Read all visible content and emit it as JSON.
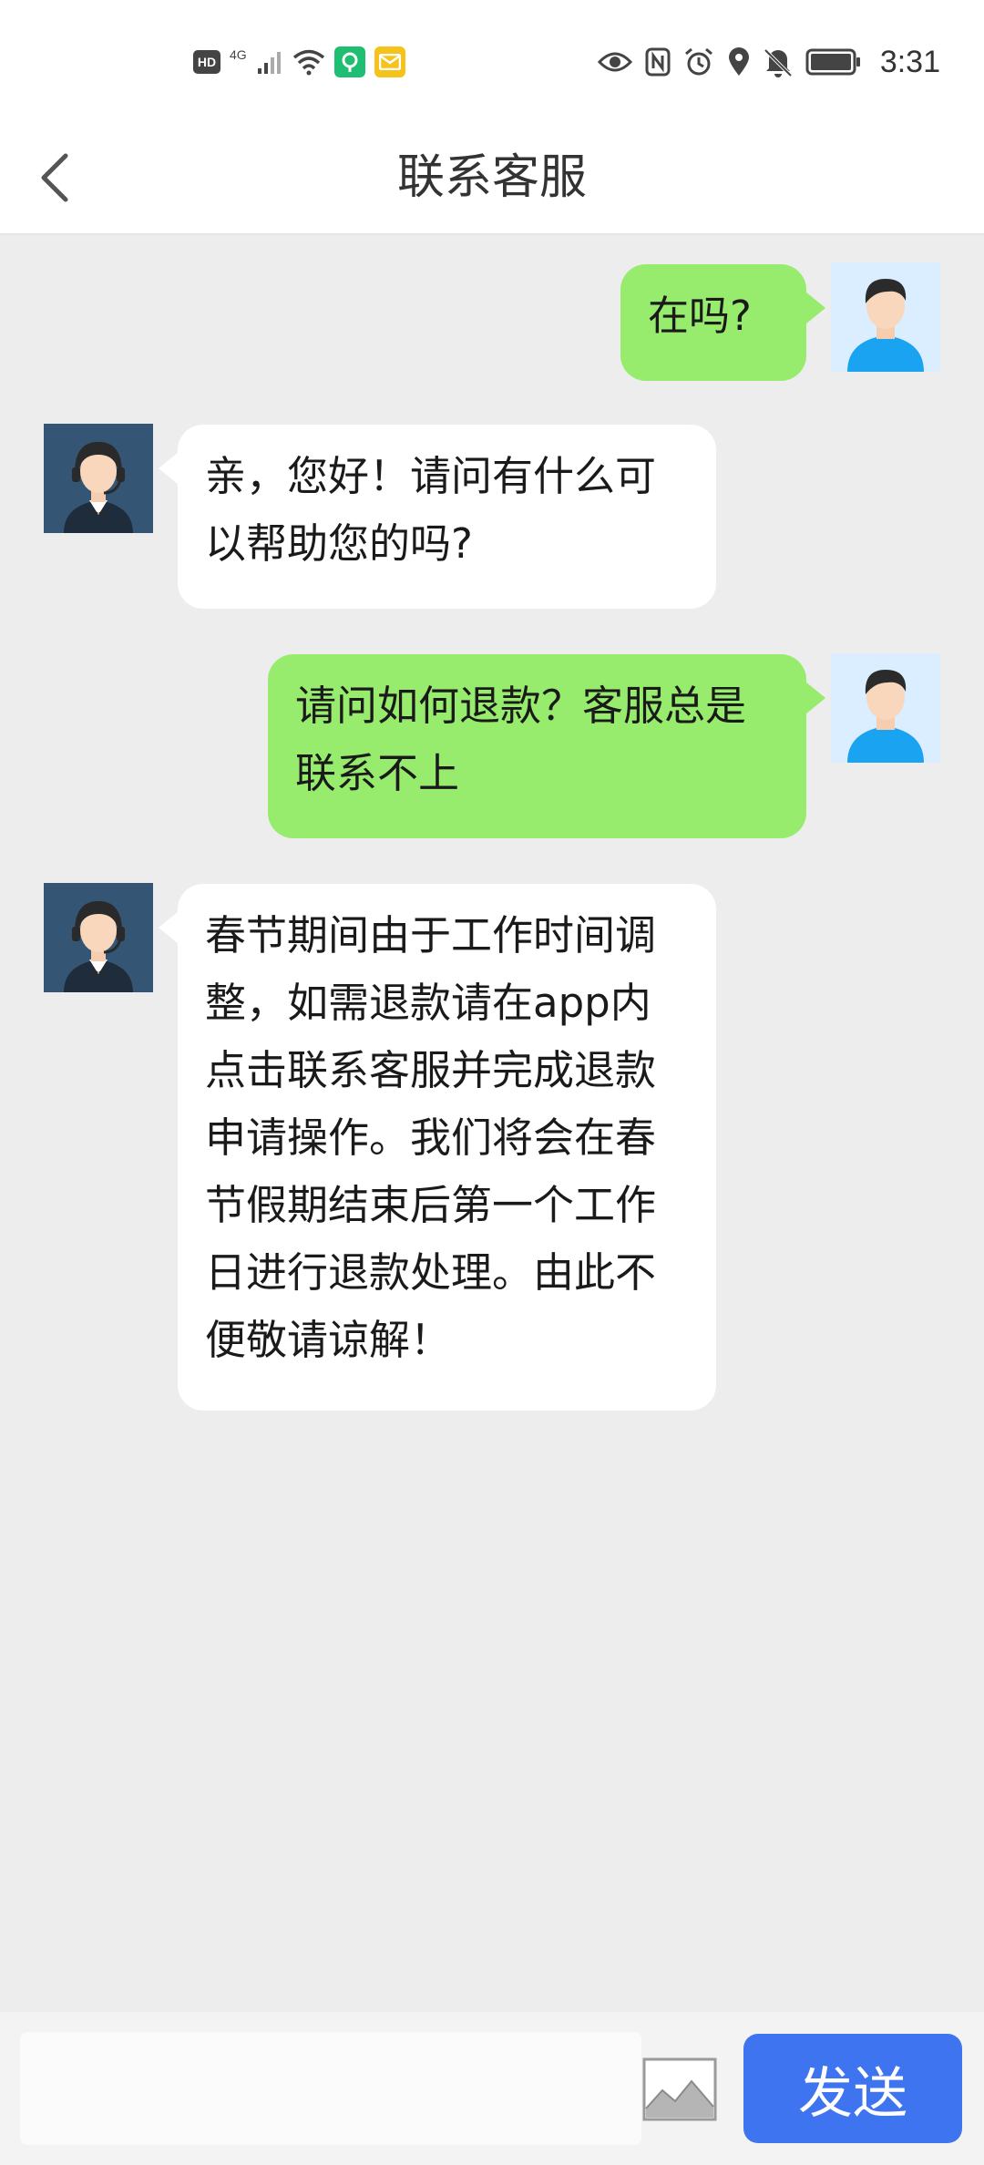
{
  "status_bar": {
    "hd_label": "HD",
    "network_label": "4G",
    "time": "3:31",
    "icons": [
      "hd-icon",
      "signal-icon",
      "wifi-icon",
      "app-notification-icon",
      "mail-notification-icon",
      "eye-icon",
      "nfc-icon",
      "alarm-icon",
      "location-icon",
      "mute-icon",
      "battery-icon"
    ]
  },
  "nav": {
    "back_icon": "chevron-left-icon",
    "title": "联系客服"
  },
  "chat": {
    "messages": [
      {
        "sender": "user",
        "text": "在吗?"
      },
      {
        "sender": "agent",
        "text": "亲，您好！请问有什么可以帮助您的吗?"
      },
      {
        "sender": "user",
        "text": "请问如何退款？客服总是联系不上"
      },
      {
        "sender": "agent",
        "text": "春节期间由于工作时间调整，如需退款请在app内点击联系客服并完成退款申请操作。我们将会在春节假期结束后第一个工作日进行退款处理。由此不便敬请谅解！"
      }
    ]
  },
  "input_bar": {
    "input_value": "",
    "image_icon": "image-icon",
    "send_label": "发送"
  },
  "colors": {
    "user_bubble": "#97ec6d",
    "agent_bubble": "#ffffff",
    "send_button": "#3f74f0",
    "chat_background": "#ededed"
  }
}
